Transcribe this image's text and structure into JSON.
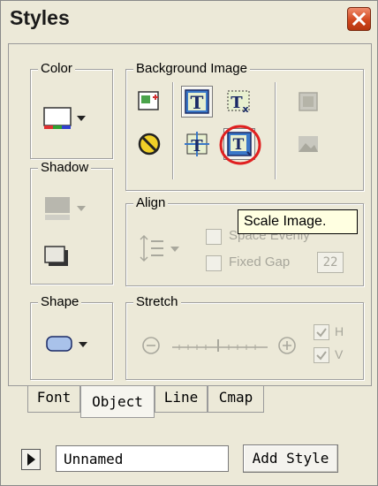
{
  "window": {
    "title": "Styles"
  },
  "groups": {
    "color": "Color",
    "background_image": "Background Image",
    "shadow": "Shadow",
    "align": "Align",
    "shape": "Shape",
    "stretch": "Stretch"
  },
  "align": {
    "space_evenly_label": "Space Evenly",
    "fixed_gap_label": "Fixed Gap",
    "fixed_gap_value": "22"
  },
  "stretch": {
    "h_label": "H",
    "v_label": "V",
    "h_checked": true,
    "v_checked": true
  },
  "tooltip": "Scale Image.",
  "tabs": [
    {
      "label": "Font"
    },
    {
      "label": "Object",
      "active": true
    },
    {
      "label": "Line"
    },
    {
      "label": "Cmap"
    }
  ],
  "footer": {
    "name_value": "Unnamed",
    "add_style_label": "Add Style"
  },
  "icons": {
    "close": "close-icon",
    "color_picker": "fill-color-icon",
    "shadow_picker": "shadow-icon",
    "shadow_box": "shadow-box-icon",
    "shape_picker": "rounded-rect-icon",
    "bg_add": "add-image-icon",
    "bg_none": "no-image-icon",
    "bg_tile": "tile-image-icon",
    "bg_scale_x": "scale-x-image-icon",
    "bg_center": "center-image-icon",
    "bg_scale": "scale-image-icon",
    "bg_crop": "crop-image-icon",
    "bg_landscape": "landscape-image-icon",
    "align_spacing": "align-spacing-icon",
    "stretch_minus": "zoom-out-icon",
    "stretch_plus": "zoom-in-icon",
    "play": "play-icon"
  },
  "colors": {
    "highlight_circle": "#e02020",
    "title_close": "#d2481f"
  }
}
